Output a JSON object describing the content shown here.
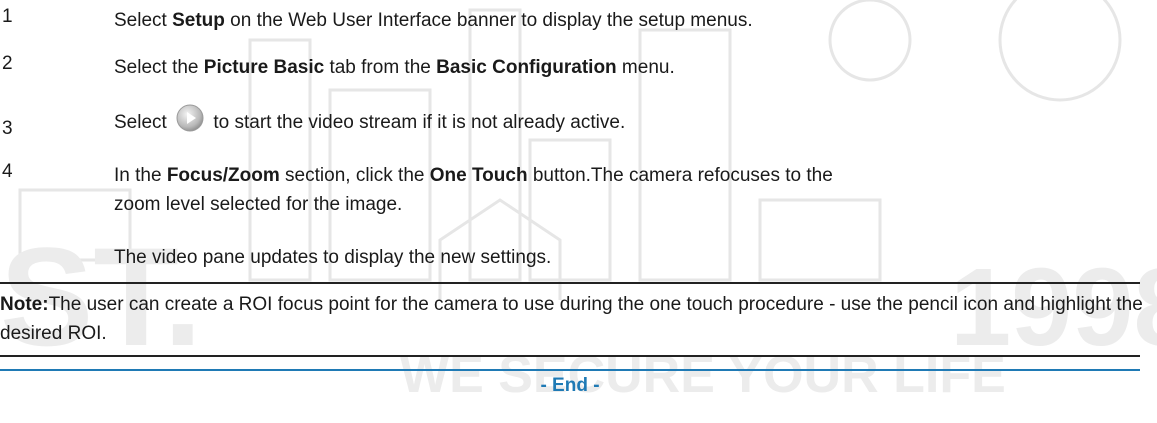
{
  "steps": [
    {
      "num": "1",
      "pre": "Select ",
      "b1": "Setup",
      "mid": " on the Web User Interface banner to display the setup menus."
    },
    {
      "num": "2",
      "pre": "Select the ",
      "b1": "Picture Basic",
      "mid": " tab from the ",
      "b2": "Basic Configuration",
      "post": " menu."
    },
    {
      "num": "3",
      "pre": "Select ",
      "post": " to start the video stream if it is not already active.",
      "icon": "play-icon"
    },
    {
      "num": "4",
      "pre": "In the ",
      "b1": "Focus/Zoom",
      "mid": " section, click the ",
      "b2": "One Touch",
      "post": " button.The camera refocuses to the zoom level selected for the image.",
      "extra": "The video pane updates to display the new settings."
    }
  ],
  "note": {
    "label": "Note:",
    "text": "The user can create a ROI focus point for the camera to use during the one touch procedure - use the pencil icon and highlight the desired ROI."
  },
  "end_label": "- End -",
  "colors": {
    "accent": "#1f7ab5",
    "text": "#1a1a1a",
    "rule": "#222222",
    "watermark": "#e9e9e9"
  }
}
